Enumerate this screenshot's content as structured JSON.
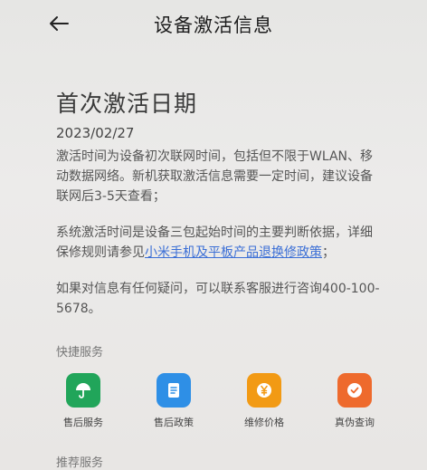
{
  "header": {
    "title": "设备激活信息"
  },
  "main": {
    "heading": "首次激活日期",
    "date": "2023/02/27",
    "para1": "激活时间为设备初次联网时间，包括但不限于WLAN、移动数据网络。新机获取激活信息需要一定时间，建议设备联网后3-5天查看；",
    "para2_prefix": "系统激活时间是设备三包起始时间的主要判断依据，详细保修规则请参见",
    "para2_link": "小米手机及平板产品退换修政策",
    "para2_suffix": "；",
    "para3": "如果对信息有任何疑问，可以联系客服进行咨询400-100-5678。"
  },
  "quick_services": {
    "label": "快捷服务",
    "items": [
      {
        "label": "售后服务",
        "icon": "umbrella-icon",
        "color": "#21a55a"
      },
      {
        "label": "售后政策",
        "icon": "document-icon",
        "color": "#2e8fe6"
      },
      {
        "label": "维修价格",
        "icon": "yen-coin-icon",
        "color": "#f29a14"
      },
      {
        "label": "真伪查询",
        "icon": "verify-badge-icon",
        "color": "#ee6a2d"
      }
    ]
  },
  "recommend": {
    "label": "推荐服务"
  }
}
